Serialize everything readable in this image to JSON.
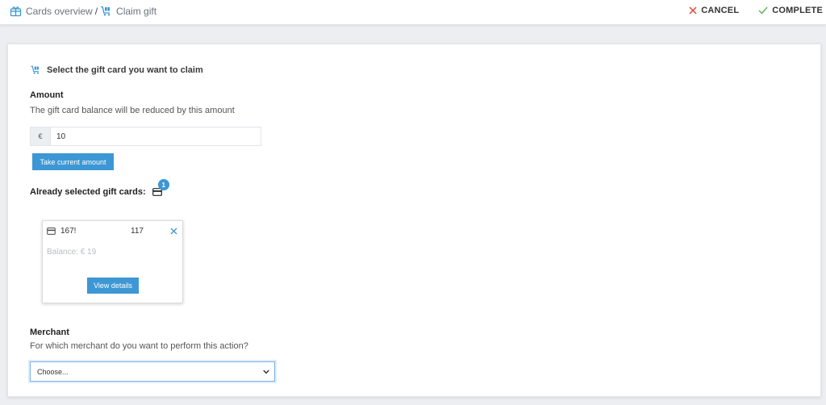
{
  "breadcrumb": {
    "items": [
      {
        "label": "Cards overview",
        "icon": "gift-box-icon"
      },
      {
        "label": "Claim gift",
        "icon": "cart-gift-icon"
      }
    ],
    "separator": "/"
  },
  "header_actions": {
    "cancel_label": "CANCEL",
    "complete_label": "COMPLETE"
  },
  "colors": {
    "accent": "#3d97d4",
    "cancel": "#e0443e",
    "complete": "#5cb85c"
  },
  "main": {
    "section_title": "Select the gift card you want to claim",
    "amount": {
      "label": "Amount",
      "description": "The gift card balance will be reduced by this amount",
      "currency": "€",
      "value": "10",
      "take_current_label": "Take current amount"
    },
    "selected_cards": {
      "label": "Already selected gift cards:",
      "count": "1",
      "cards": [
        {
          "number_start": "167!",
          "number_end": "117",
          "balance": "Balance: € 19",
          "view_details_label": "View details"
        }
      ]
    },
    "merchant": {
      "label": "Merchant",
      "description": "For which merchant do you want to perform this action?",
      "selected": "Choose..."
    }
  }
}
